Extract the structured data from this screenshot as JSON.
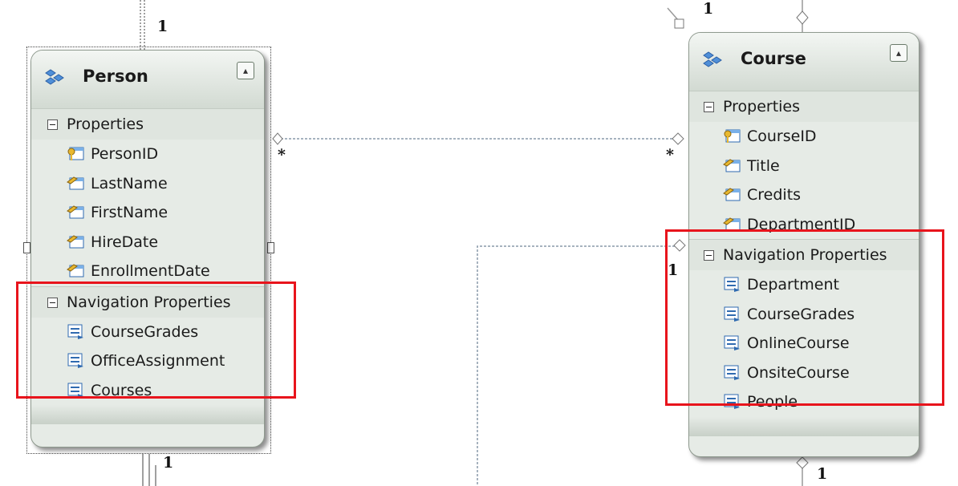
{
  "entities": {
    "person": {
      "title": "Person",
      "properties_label": "Properties",
      "properties": [
        "PersonID",
        "LastName",
        "FirstName",
        "HireDate",
        "EnrollmentDate"
      ],
      "navigation_label": "Navigation Properties",
      "navigation": [
        "CourseGrades",
        "OfficeAssignment",
        "Courses"
      ]
    },
    "course": {
      "title": "Course",
      "properties_label": "Properties",
      "properties": [
        "CourseID",
        "Title",
        "Credits",
        "DepartmentID"
      ],
      "navigation_label": "Navigation Properties",
      "navigation": [
        "Department",
        "CourseGrades",
        "OnlineCourse",
        "OnsiteCourse",
        "People"
      ]
    }
  },
  "multiplicities": {
    "person_top": "1",
    "person_bottom": "1",
    "person_to_course_left": "*",
    "person_to_course_right": "*",
    "course_top": "1",
    "course_department": "1",
    "course_bottom": "1"
  },
  "icons": {
    "entity": "entity-type-icon",
    "key_property": "key-property-icon",
    "property": "scalar-property-icon",
    "navigation": "navigation-property-icon",
    "collapse": "chevron-double-up-icon",
    "expand": "minus-box-icon"
  },
  "colors": {
    "highlight": "#e8141c",
    "entity_body": "#e6ebe6",
    "connector": "#8a9aaa"
  }
}
